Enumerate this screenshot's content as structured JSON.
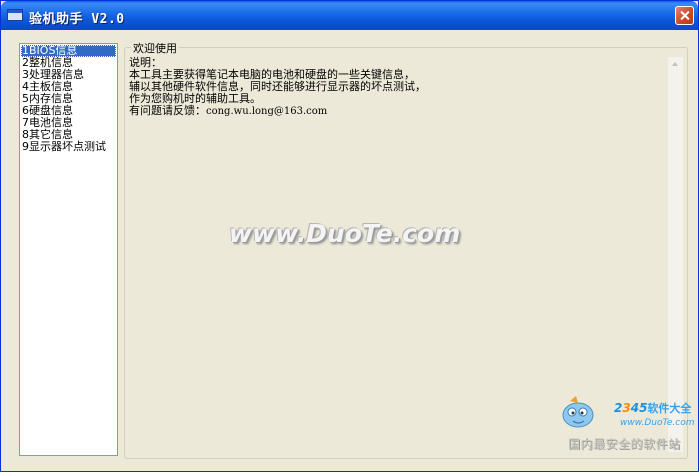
{
  "window": {
    "title": "验机助手 V2.0"
  },
  "nav": {
    "items": [
      {
        "label": "1BIOS信息",
        "selected": true
      },
      {
        "label": "2整机信息",
        "selected": false
      },
      {
        "label": "3处理器信息",
        "selected": false
      },
      {
        "label": "4主板信息",
        "selected": false
      },
      {
        "label": "5内存信息",
        "selected": false
      },
      {
        "label": "6硬盘信息",
        "selected": false
      },
      {
        "label": "7电池信息",
        "selected": false
      },
      {
        "label": "8其它信息",
        "selected": false
      },
      {
        "label": "9显示器坏点测试",
        "selected": false
      }
    ]
  },
  "content": {
    "group_title": "欢迎使用",
    "lines": [
      "说明：",
      "本工具主要获得笔记本电脑的电池和硬盘的一些关键信息，",
      "辅以其他硬件软件信息，同时还能够进行显示器的坏点测试，",
      "作为您购机时的辅助工具。"
    ],
    "feedback_label": "有问题请反馈：",
    "feedback_email": "cong.wu.long@163.com"
  },
  "watermark": {
    "text": "www.DuoTe.com"
  },
  "logo": {
    "brand_part1": "2",
    "brand_part2": "3",
    "brand_part3": "45",
    "brand_cn": "软件大全",
    "url": "www.DuoTe.com",
    "slogan": "国内最安全的软件站"
  },
  "colors": {
    "titlebar": "#0a54d8",
    "selection": "#316ac5",
    "face": "#ece9d8"
  }
}
